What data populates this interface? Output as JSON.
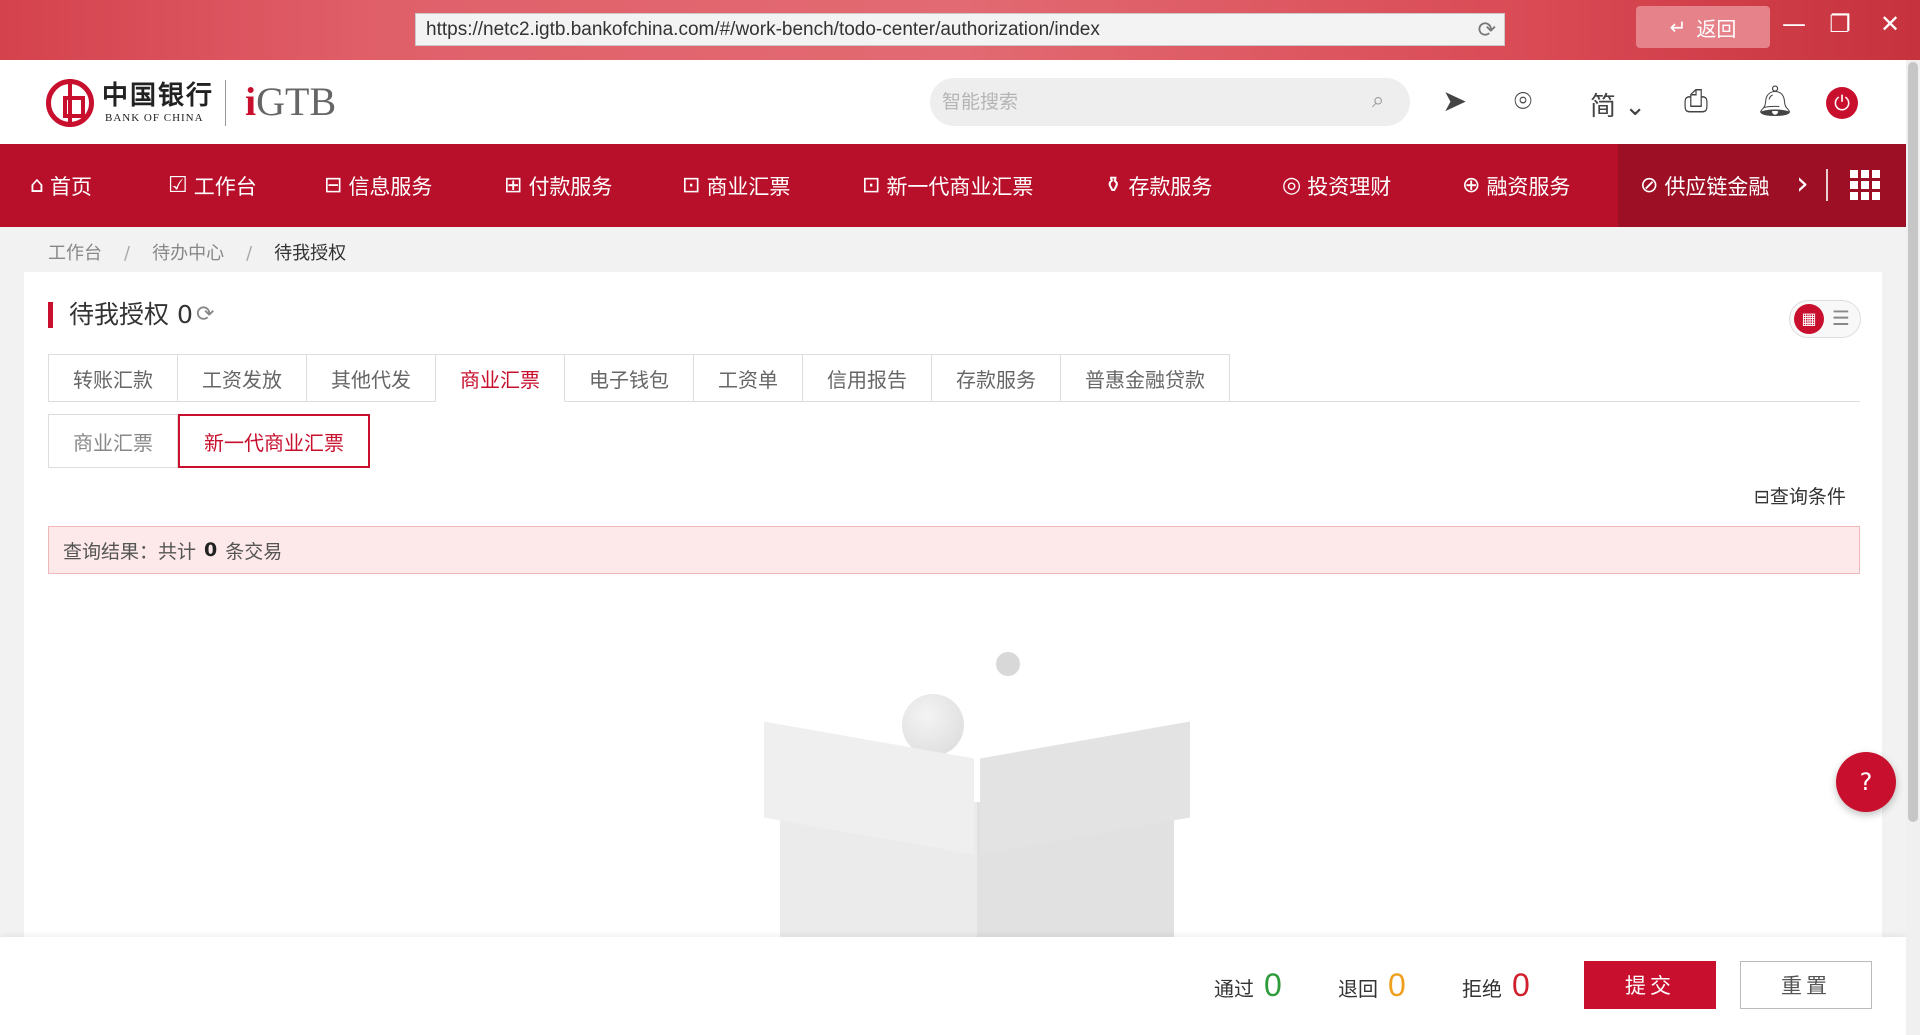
{
  "window": {
    "url": "https://netc2.igtb.bankofchina.com/#/work-bench/todo-center/authorization/index",
    "back_label": "返回"
  },
  "header": {
    "logo_cn": "中国银行",
    "logo_en": "BANK OF CHINA",
    "logo_gtb": "GTB",
    "search_placeholder": "智能搜索",
    "lang": "简"
  },
  "nav": {
    "items": [
      {
        "label": "首页",
        "icon": "home-icon"
      },
      {
        "label": "工作台",
        "icon": "workbench-icon"
      },
      {
        "label": "信息服务",
        "icon": "info-icon"
      },
      {
        "label": "付款服务",
        "icon": "payment-icon"
      },
      {
        "label": "商业汇票",
        "icon": "bill-icon"
      },
      {
        "label": "新一代商业汇票",
        "icon": "bill-icon"
      },
      {
        "label": "存款服务",
        "icon": "deposit-icon"
      },
      {
        "label": "投资理财",
        "icon": "invest-icon"
      },
      {
        "label": "融资服务",
        "icon": "finance-icon"
      },
      {
        "label": "供应链金融",
        "icon": "link-icon"
      }
    ]
  },
  "breadcrumb": {
    "items": [
      "工作台",
      "待办中心",
      "待我授权"
    ]
  },
  "panel": {
    "title": "待我授权",
    "count": "0",
    "tabs": [
      "转账汇款",
      "工资发放",
      "其他代发",
      "商业汇票",
      "电子钱包",
      "工资单",
      "信用报告",
      "存款服务",
      "普惠金融贷款"
    ],
    "active_tab": "商业汇票",
    "subtabs": [
      "商业汇票",
      "新一代商业汇票"
    ],
    "active_subtab": "新一代商业汇票",
    "query_label": "查询条件",
    "result_prefix": "查询结果：共计",
    "result_count": "0",
    "result_suffix": "条交易"
  },
  "footer": {
    "pass_label": "通过",
    "pass_count": "0",
    "pass_color": "#2e9b3a",
    "return_label": "退回",
    "return_count": "0",
    "return_color": "#f0a020",
    "reject_label": "拒绝",
    "reject_count": "0",
    "reject_color": "#d0202e",
    "submit_label": "提交",
    "reset_label": "重置"
  },
  "colors": {
    "brand": "#c8102e",
    "nav_bg": "#b8102a"
  }
}
